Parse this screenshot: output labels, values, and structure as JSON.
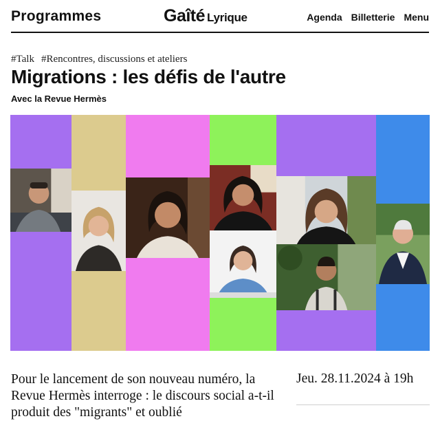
{
  "header": {
    "programmes": "Programmes",
    "logo_main": "Gaîté",
    "logo_sub": "Lyrique",
    "nav": [
      "Agenda",
      "Billetterie",
      "Menu"
    ]
  },
  "event": {
    "tags": [
      "#Talk",
      "#Rencontres, discussions et ateliers"
    ],
    "title": "Migrations : les défis de l'autre",
    "subtitle": "Avec la Revue Hermès",
    "description": "Pour le lancement de son nouveau numéro, la Revue Hermès interroge : le discours social a-t-il produit des \"migrants\" et oublié",
    "date": "Jeu. 28.11.2024 à 19h"
  },
  "hero": {
    "colors": {
      "purple": "#a56ff0",
      "sand": "#dccb8e",
      "pink": "#f07bef",
      "green": "#8ef25a",
      "blue": "#3e8bea"
    },
    "speaker_photos": 8
  }
}
